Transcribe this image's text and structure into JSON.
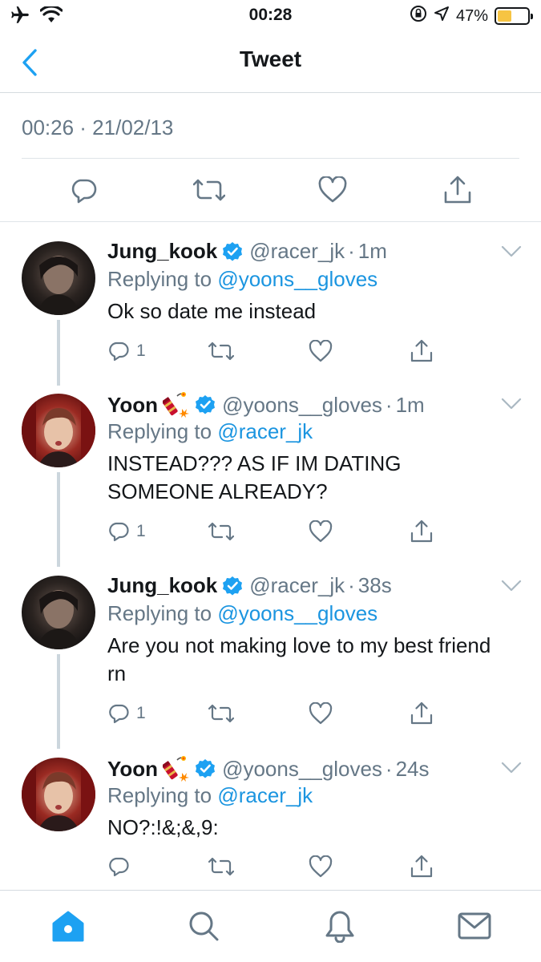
{
  "status_bar": {
    "time": "00:28",
    "battery": "47%",
    "battery_level": 0.47,
    "battery_color": "#f6c443"
  },
  "nav": {
    "title": "Tweet",
    "back_icon": "chevron-left-icon"
  },
  "main_tweet": {
    "timestamp": "00:26 · 21/02/13"
  },
  "replies": [
    {
      "name": "Jung_kook",
      "handle": "@racer_jk",
      "time": "1m",
      "replying_label": "Replying to",
      "replying_to": "@yoons__gloves",
      "text": "Ok so date me instead",
      "reply_count": "1",
      "emoji": ""
    },
    {
      "name": "Yoon",
      "handle": "@yoons__gloves",
      "time": "1m",
      "replying_label": "Replying to",
      "replying_to": "@racer_jk",
      "text": "INSTEAD??? AS IF IM DATING SOMEONE ALREADY?",
      "reply_count": "1",
      "emoji": "firecracker-icon"
    },
    {
      "name": "Jung_kook",
      "handle": "@racer_jk",
      "time": "38s",
      "replying_label": "Replying to",
      "replying_to": "@yoons__gloves",
      "text": "Are you not making love to my best friend rn",
      "reply_count": "1",
      "emoji": ""
    },
    {
      "name": "Yoon",
      "handle": "@yoons__gloves",
      "time": "24s",
      "replying_label": "Replying to",
      "replying_to": "@racer_jk",
      "text": "NO?:!&;&,9:",
      "reply_count": "",
      "emoji": "firecracker-icon"
    }
  ],
  "tab_bar": {
    "items": [
      "home-icon",
      "search-icon",
      "notifications-icon",
      "messages-icon"
    ],
    "active_color": "#1da1f2"
  },
  "colors": {
    "accent": "#1da1f2",
    "mention": "#1b95e0",
    "muted": "#657786",
    "verified": "#1da1f2"
  }
}
